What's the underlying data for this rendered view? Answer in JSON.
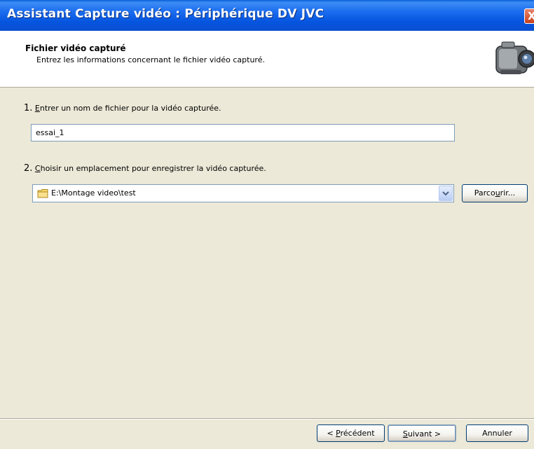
{
  "window": {
    "title": "Assistant Capture vidéo : Périphérique DV JVC",
    "close_label": "X"
  },
  "header": {
    "title": "Fichier vidéo capturé",
    "subtitle": "Entrez les informations concernant le fichier vidéo capturé.",
    "icon": "camcorder-icon"
  },
  "step1": {
    "number": "1.",
    "label_mnemonic": "E",
    "label_rest": "ntrer un nom de fichier pour la vidéo capturée.",
    "filename_value": "essai_1"
  },
  "step2": {
    "number": "2.",
    "label_mnemonic": "C",
    "label_rest": "hoisir un emplacement pour enregistrer la vidéo capturée.",
    "location_value": "E:\\Montage video\\test",
    "folder_icon": "folder-icon",
    "browse_pre": "Parco",
    "browse_mnemonic": "u",
    "browse_post": "rir..."
  },
  "footer": {
    "prev_pre": "< ",
    "prev_mnemonic": "P",
    "prev_post": "récédent",
    "next_mnemonic": "S",
    "next_post": "uivant >",
    "cancel_label": "Annuler"
  },
  "colors": {
    "title_bar": "#0a4fd0",
    "dialog_bg": "#ece9d8",
    "button_border": "#003c74"
  }
}
